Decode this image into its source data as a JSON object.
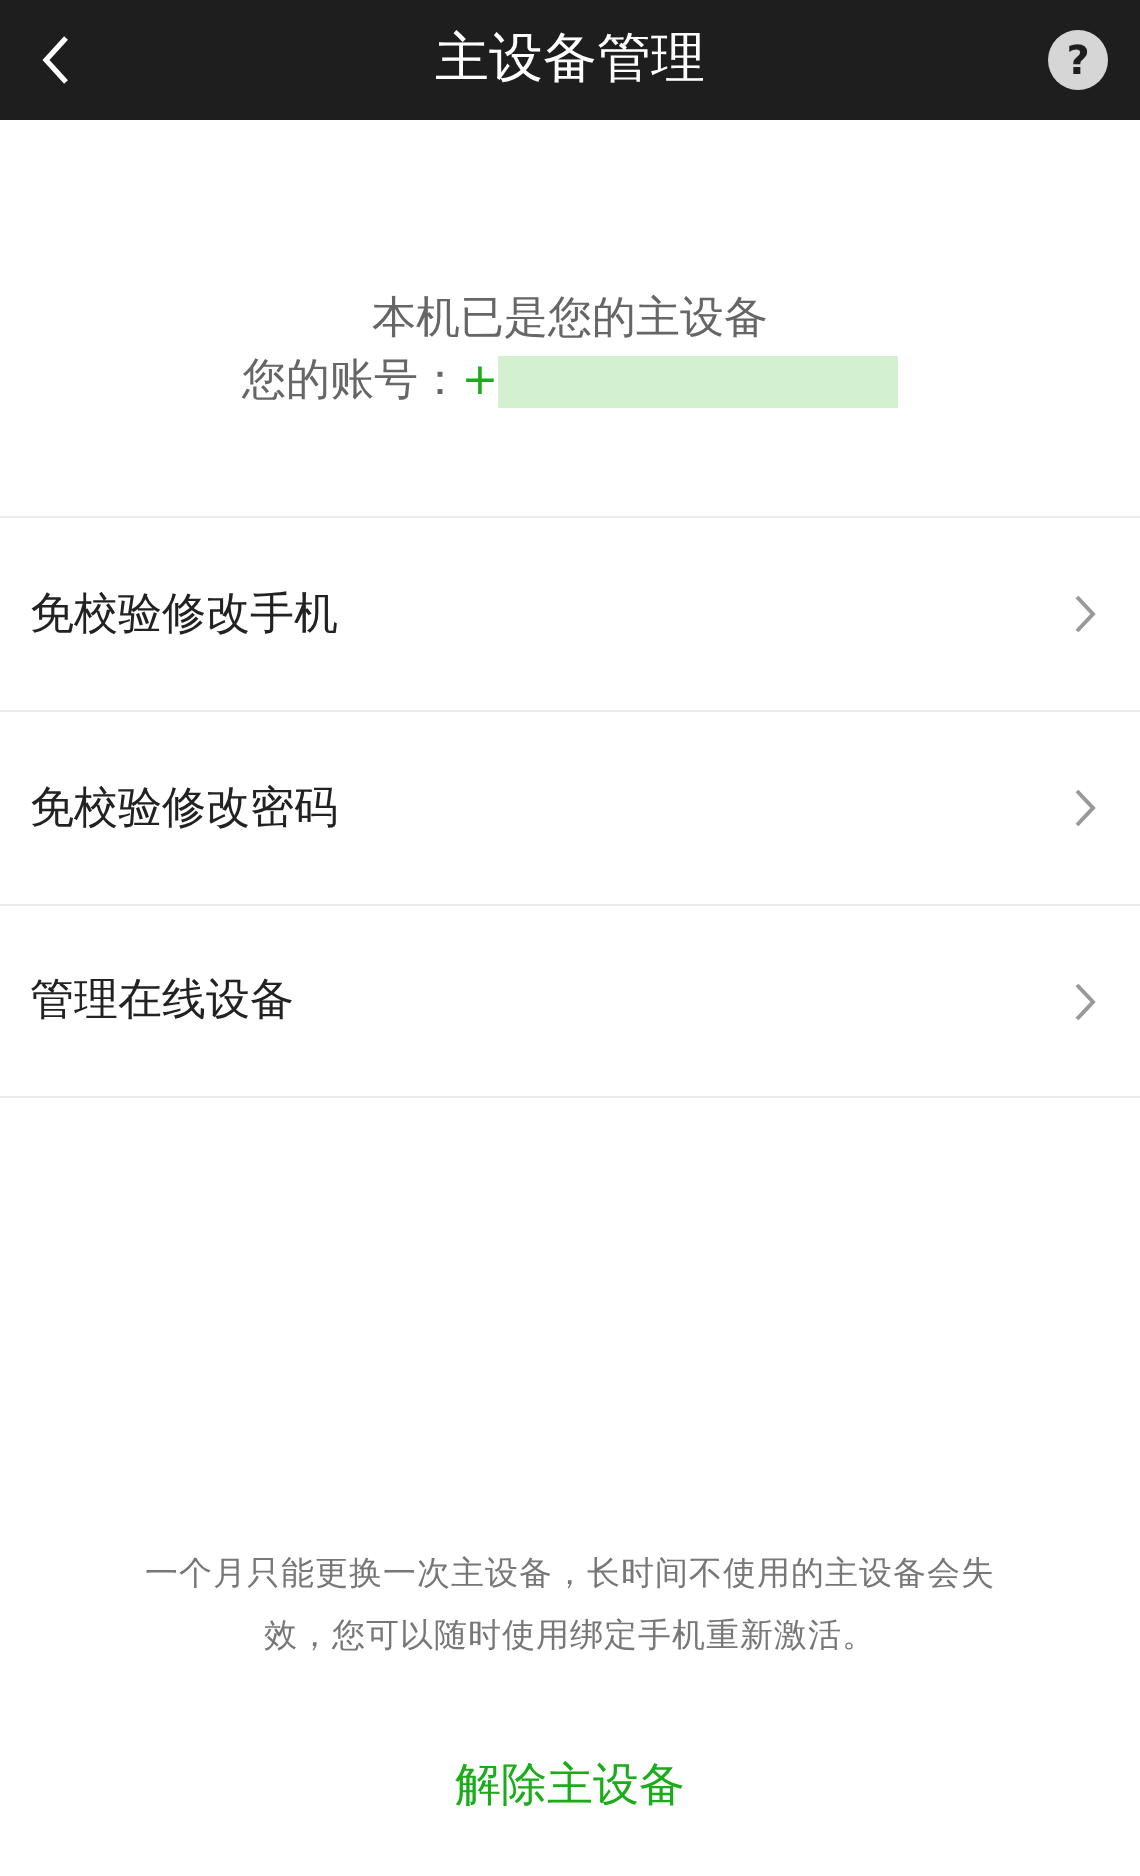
{
  "header": {
    "title": "主设备管理",
    "help": "?"
  },
  "status": {
    "message": "本机已是您的主设备",
    "account_label": "您的账号：",
    "account_value": "+"
  },
  "menu": [
    {
      "label": "免校验修改手机"
    },
    {
      "label": "免校验修改密码"
    },
    {
      "label": "管理在线设备"
    }
  ],
  "note": "一个月只能更换一次主设备，长时间不使用的主设备会失效，您可以随时使用绑定手机重新激活。",
  "action": "解除主设备"
}
